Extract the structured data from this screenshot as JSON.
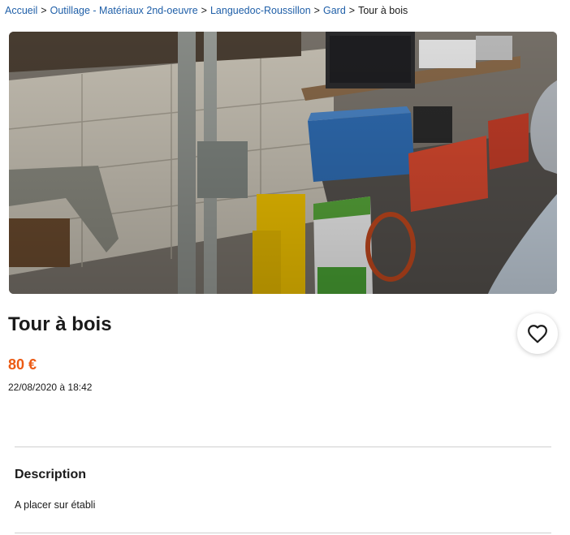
{
  "breadcrumb": {
    "items": [
      {
        "label": "Accueil"
      },
      {
        "label": "Outillage - Matériaux 2nd-oeuvre"
      },
      {
        "label": "Languedoc-Roussillon"
      },
      {
        "label": "Gard"
      }
    ],
    "current": "Tour à bois",
    "separator": ">"
  },
  "listing": {
    "title": "Tour à bois",
    "price": "80 €",
    "date": "22/08/2020 à 18:42",
    "favorite_icon": "heart-icon"
  },
  "description": {
    "heading": "Description",
    "text": "A placer sur établi"
  },
  "colors": {
    "link": "#1f5fa8",
    "price": "#ec5a13",
    "divider": "#cfcfcf"
  }
}
